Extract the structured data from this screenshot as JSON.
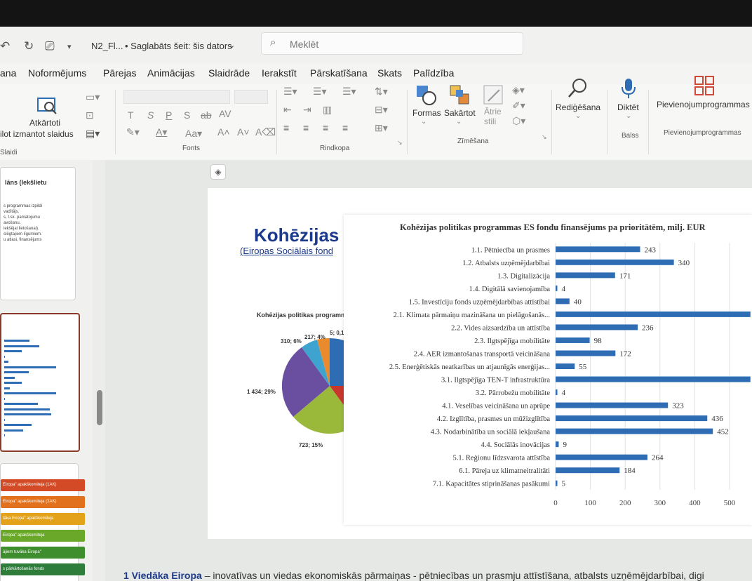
{
  "titlebar": {
    "doc_name": "N2_Fl...",
    "save_status": "• Saglabāts šeit: šis dators",
    "search_placeholder": "Meklēt"
  },
  "tabs": [
    "ana",
    "Noformējums",
    "Pārejas",
    "Animācijas",
    "Slaidrāde",
    "Ierakstīt",
    "Pārskatīšana",
    "Skats",
    "Palīdzība"
  ],
  "ribbon": {
    "reuse_line1": "Atkārtoti",
    "reuse_line2": "ilot izmantot slaidus",
    "slides_group": "Slaidi",
    "font_group": "Fonts",
    "paragraph_group": "Rindkopa",
    "drawing_group": "Zīmēšana",
    "shapes": "Formas",
    "arrange": "Sakārtot",
    "styles_line1": "Ātrie",
    "styles_line2": "stili",
    "editing": "Rediģēšana",
    "dictate": "Diktēt",
    "voice_group": "Balss",
    "addins": "Pievienojumprogrammas",
    "addins_group": "Pievienojumprogrammas",
    "font_letters": [
      "T",
      "S",
      "P",
      "S",
      "ab",
      "AV"
    ]
  },
  "thumb1": {
    "title": "lāns (Iekšlietu",
    "lines": [
      "s programmas izpildi",
      "vadītājs.",
      "s, t.sk. pamatojumu",
      "avošanu.",
      "iekšējai lietošanai).",
      "slēgtajiem līgumiem.",
      "u atlasi, finansējums"
    ]
  },
  "tags": [
    {
      "label": "Eiropa\" apakškomiteja (1AK)",
      "color": "#d24a26"
    },
    {
      "label": "Eiropa\" apakškomiteja (2AK)",
      "color": "#e2711d"
    },
    {
      "label": "tāka Eiropa\" apakškomiteja",
      "color": "#e3a21a"
    },
    {
      "label": "Eiropa\" apakškomiteja",
      "color": "#6aa82a"
    },
    {
      "label": "ājiem tuvāka Eiropa\"",
      "color": "#3e8e2e"
    },
    {
      "label": "s pārkārtošanās fonds",
      "color": "#2f7d3a"
    }
  ],
  "slide": {
    "title": "Kohēzijas",
    "subtitle": "(Eiropas Sociālais fond",
    "pie_title": "Kohēzijas politikas programm",
    "pie_labels": [
      "310; 6%",
      "217; 4%",
      "5; 0,1",
      "1 434; 29%",
      "723; 15%"
    ]
  },
  "copilot_icon": "copilot-icon",
  "bottom": {
    "bold": "1 Viedāka Eiropa",
    "rest": " – inovatīvas un viedas ekonomiskās pārmaiņas - pētniecības un prasmju attīstīšana, atbalsts uzņēmējdarbībai, digi"
  },
  "chart_data": {
    "type": "bar",
    "orientation": "horizontal",
    "title": "Kohēzijas politikas programmas ES fondu finansējums pa prioritātēm, milj. EUR",
    "xlabel": "",
    "ylabel": "",
    "xlim": [
      0,
      500
    ],
    "xticks": [
      0,
      100,
      200,
      300,
      400,
      500
    ],
    "grid": true,
    "bar_color": "#2e6db4",
    "categories": [
      "1.1. Pētniecība un prasmes",
      "1.2. Atbalsts uzņēmējdarbībai",
      "1.3. Digitalizācija",
      "1.4. Digitālā savienojamība",
      "1.5. Investīciju fonds uzņēmējdarbības attīstībai",
      "2.1. Klimata pārmaiņu mazināšana un pielāgošanās...",
      "2.2. Vides aizsardzība un attīstība",
      "2.3. Ilgtspējīga mobilitāte",
      "2.4. AER izmantošanas transportā veicināšana",
      "2.5. Enerģētiskās neatkarības un atjaunīgās enerģijas...",
      "3.1. Ilgtspējīga TEN-T infrastruktūra",
      "3.2. Pārrobežu mobilitāte",
      "4.1. Veselības veicināšana un aprūpe",
      "4.2. Izglītība, prasmes un mūžizglītība",
      "4.3. Nodarbinātība un sociālā iekļaušana",
      "4.4. Sociālās inovācijas",
      "5.1. Reģionu līdzsvarota attīstība",
      "6.1. Pāreja uz klimatneitralitāti",
      "7.1. Kapacitātes stiprināšanas pasākumi"
    ],
    "values": [
      243,
      340,
      171,
      4,
      40,
      600,
      236,
      98,
      172,
      55,
      600,
      4,
      323,
      436,
      452,
      9,
      264,
      184,
      5
    ],
    "data_labels": [
      "243",
      "340",
      "171",
      "4",
      "40",
      "",
      "236",
      "98",
      "172",
      "55",
      "",
      "4",
      "323",
      "436",
      "452",
      "9",
      "264",
      "184",
      "5"
    ]
  }
}
